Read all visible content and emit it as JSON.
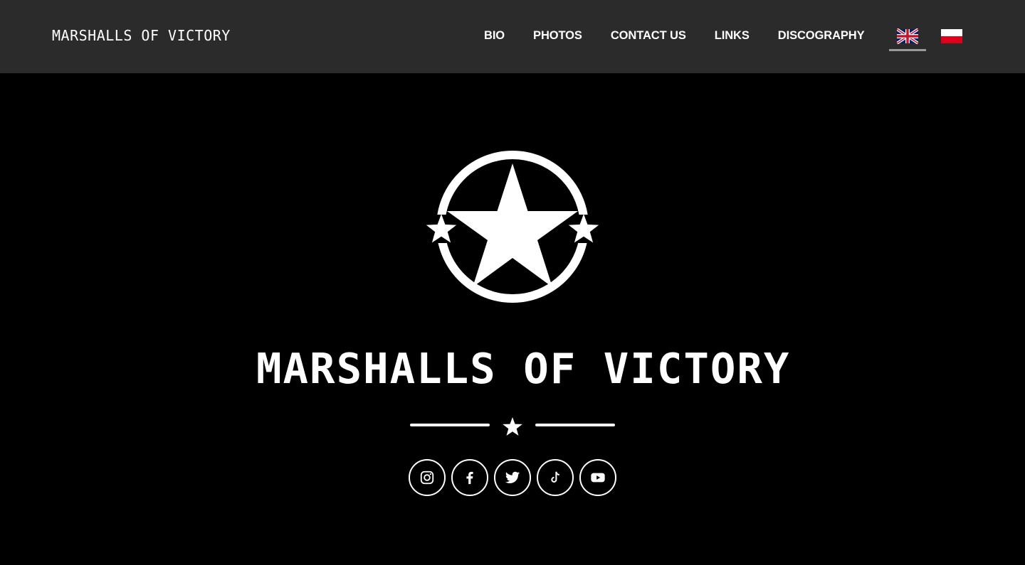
{
  "header": {
    "brand": "MARSHALLS OF VICTORY",
    "nav": [
      {
        "label": "BIO"
      },
      {
        "label": "PHOTOS"
      },
      {
        "label": "CONTACT US"
      },
      {
        "label": "LINKS"
      },
      {
        "label": "DISCOGRAPHY"
      }
    ],
    "languages": [
      {
        "icon": "uk-flag-icon",
        "active": true
      },
      {
        "icon": "poland-flag-icon",
        "active": false
      }
    ]
  },
  "hero": {
    "emblem_icon": "star-circle-emblem-icon",
    "wordmark": "MARSHALLS OF VICTORY",
    "divider_icon": "star-icon"
  },
  "socials": [
    {
      "icon": "instagram-icon"
    },
    {
      "icon": "facebook-icon"
    },
    {
      "icon": "twitter-icon"
    },
    {
      "icon": "tiktok-icon"
    },
    {
      "icon": "youtube-icon"
    }
  ],
  "colors": {
    "header_bg": "#2b2b2b",
    "page_bg": "#000000",
    "foreground": "#ffffff",
    "active_underline": "#9a9a9a"
  }
}
